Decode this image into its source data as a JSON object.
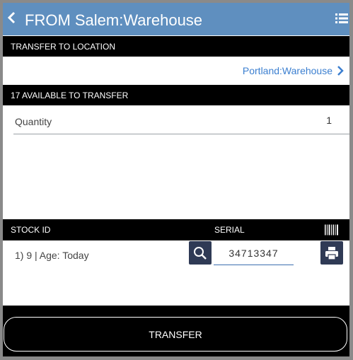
{
  "header": {
    "title": "FROM Salem:Warehouse",
    "back_icon": "chevron-left-icon",
    "menu_icon": "list-menu-icon"
  },
  "transfer_to": {
    "section_label": "TRANSFER TO LOCATION",
    "location": "Portland:Warehouse"
  },
  "available": {
    "section_label": "17 AVAILABLE TO TRANSFER",
    "quantity_label": "Quantity",
    "quantity_value": "1"
  },
  "stock_table": {
    "col_stock_id": "STOCK ID",
    "col_serial": "SERIAL",
    "rows": [
      {
        "stock": "1) 9 | Age: Today",
        "serial": "34713347"
      }
    ]
  },
  "footer": {
    "transfer_label": "TRANSFER"
  },
  "colors": {
    "header_bg": "#5f8fbf",
    "link": "#3b7fd0",
    "icon_button_bg": "#2f3a55",
    "section_bar": "#000000"
  }
}
